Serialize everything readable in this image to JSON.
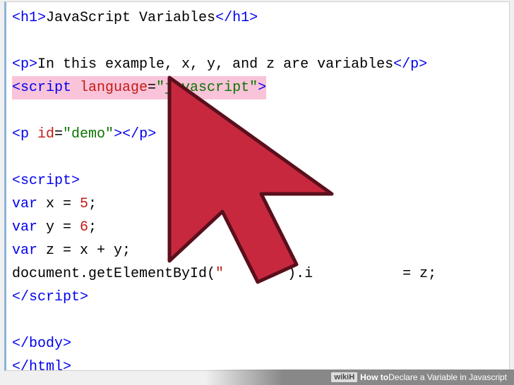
{
  "code": {
    "l1_open": "<h1>",
    "l1_text": "JavaScript Variables",
    "l1_close": "</h1>",
    "l3_open": "<p>",
    "l3_text": "In this example, x, y, and z are variables",
    "l3_close": "</p>",
    "l4_tag_open": "<script ",
    "l4_attr_name": "language",
    "l4_attr_eq": "=",
    "l4_attr_val": "\"javascript\"",
    "l4_tag_close": ">",
    "l6_open": "<p ",
    "l6_attr_name": "id",
    "l6_attr_eq": "=",
    "l6_attr_val": "\"demo\"",
    "l6_mid": ">",
    "l6_close": "</p>",
    "l8_open": "<script>",
    "l9_var": "var",
    "l9_rest": " x = ",
    "l9_num": "5",
    "l9_semi": ";",
    "l10_var": "var",
    "l10_rest": " y = ",
    "l10_num": "6",
    "l10_semi": ";",
    "l11_var": "var",
    "l11_rest": " z = x + y;",
    "l12_a": "document.getElementById(",
    "l12_str": "\"",
    "l12_b": ").i",
    "l12_c": " = z;",
    "l13_close": "</script>",
    "l15_body": "</body>",
    "l16_html": "</html>"
  },
  "footer": {
    "logo": "wikiH",
    "prefix": "How to ",
    "title": "Declare a Variable in Javascript"
  }
}
